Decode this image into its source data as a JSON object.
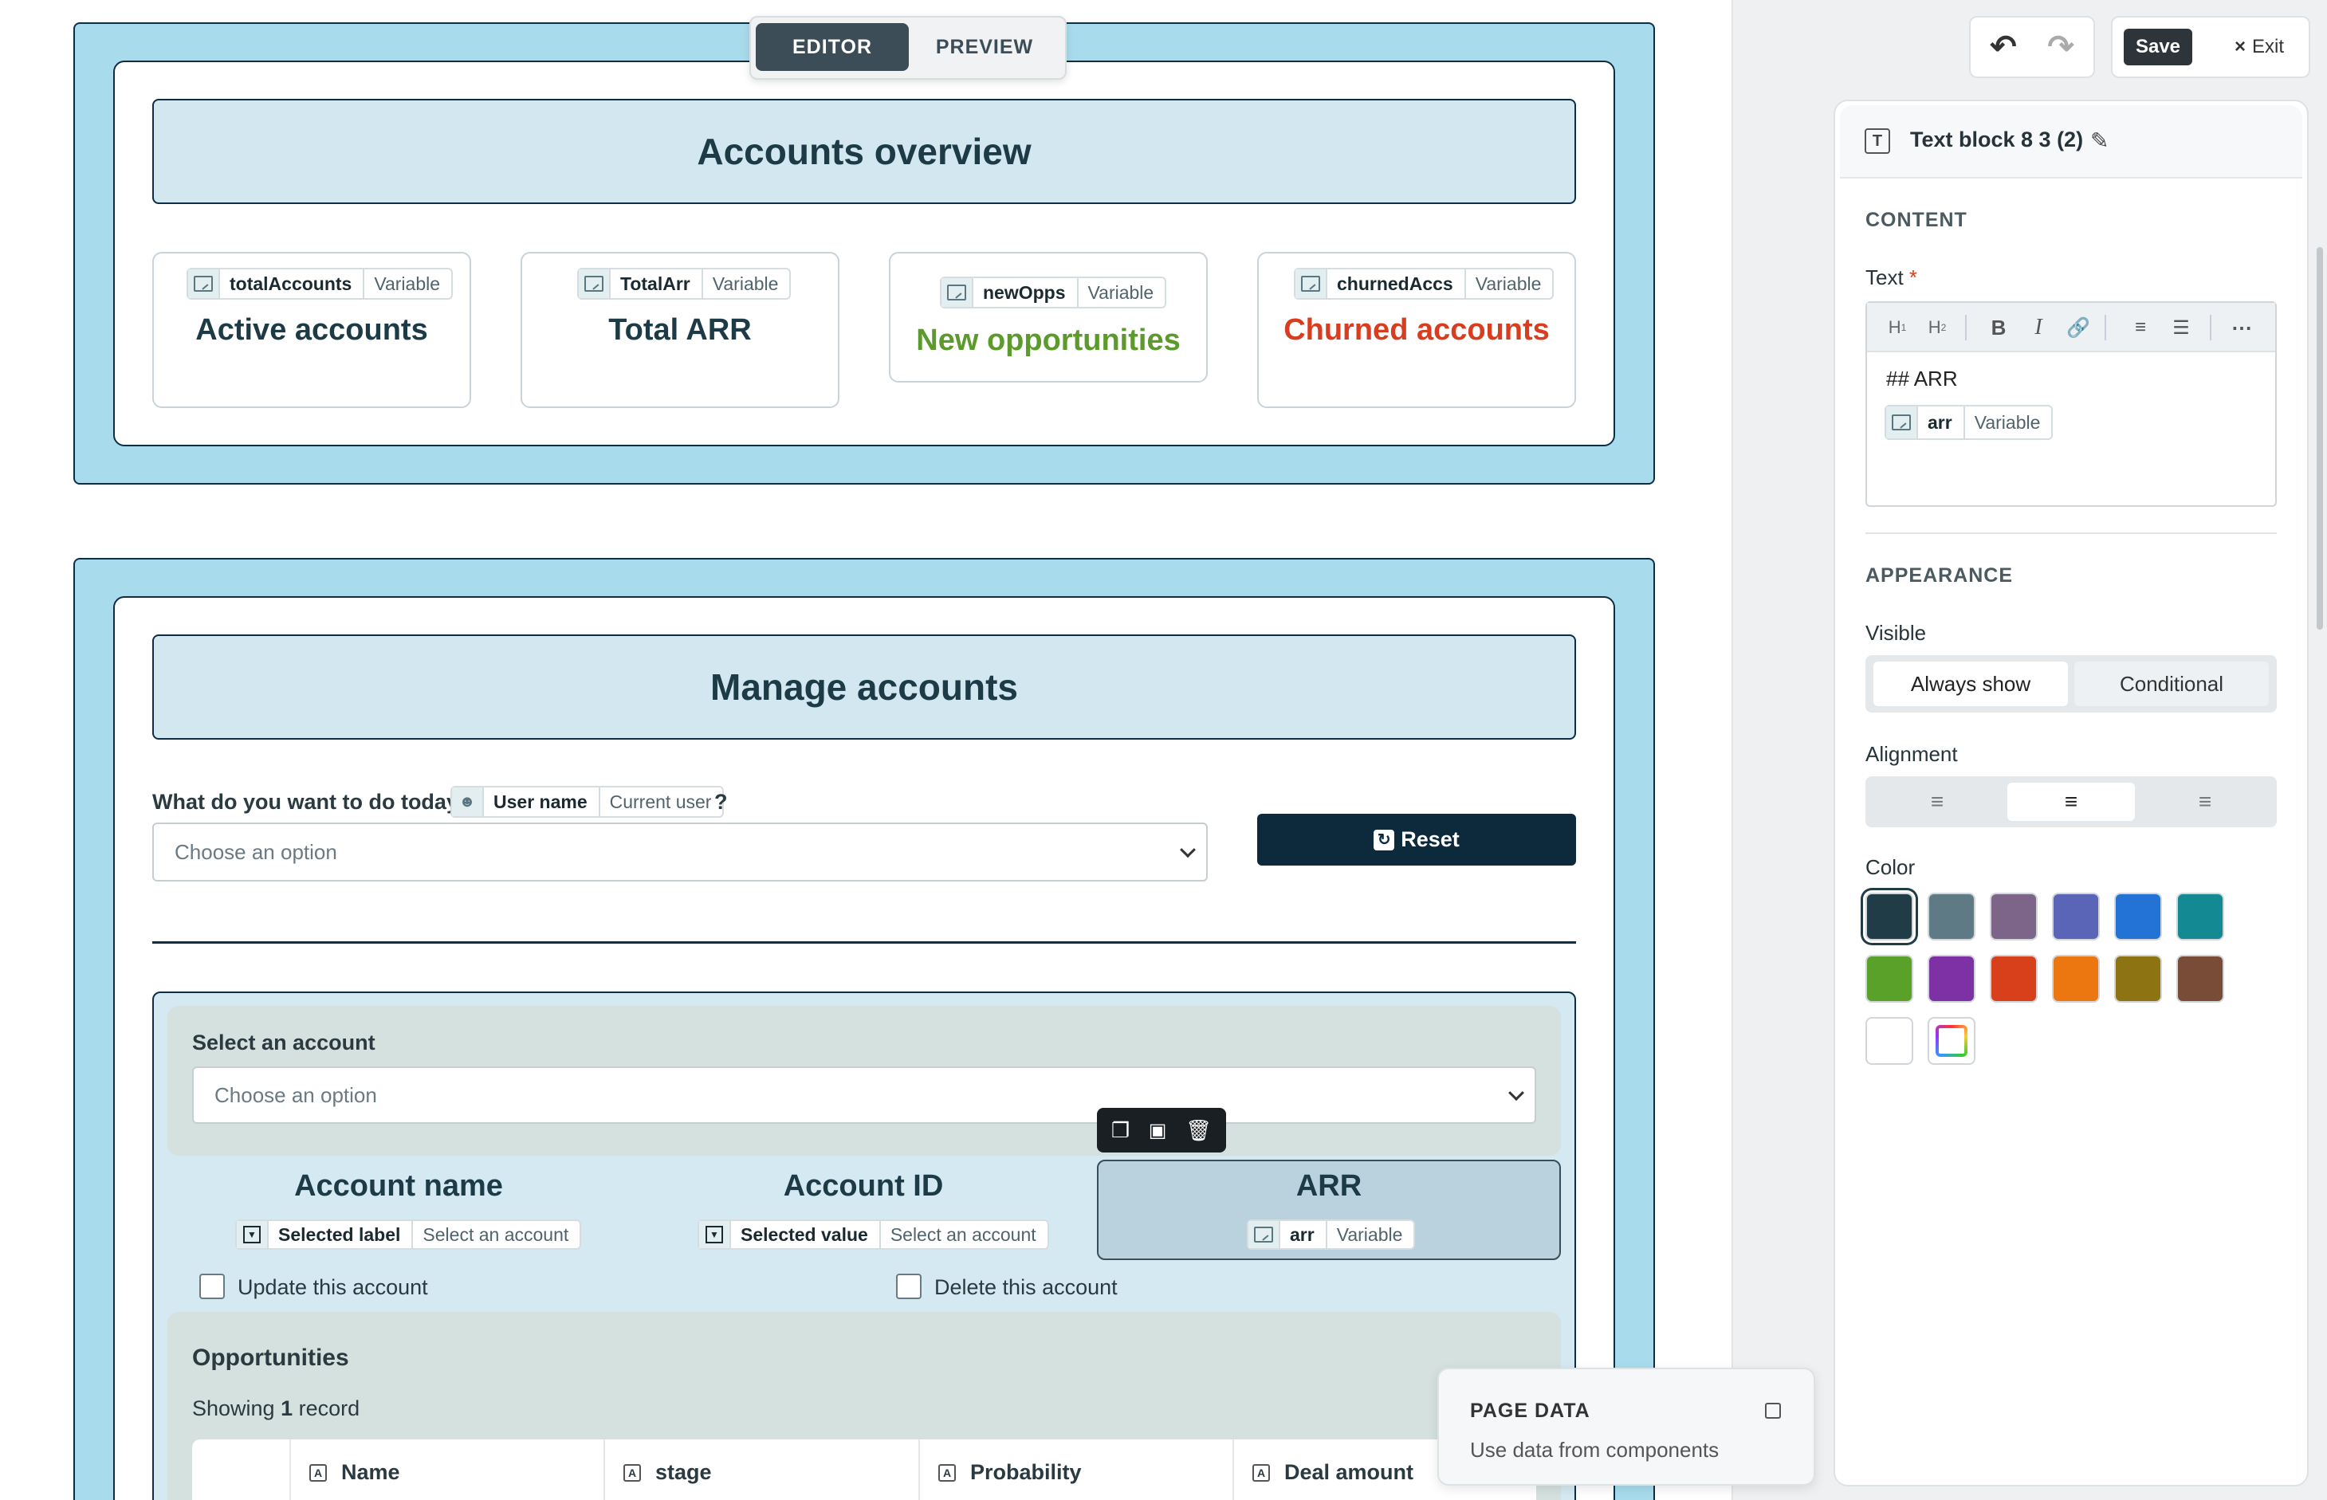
{
  "mode_toggle": {
    "editor": "EDITOR",
    "preview": "PREVIEW"
  },
  "toolbar": {
    "save": "Save",
    "exit": "Exit"
  },
  "overview": {
    "title": "Accounts overview",
    "cards": [
      {
        "var_name": "totalAccounts",
        "var_type": "Variable",
        "label": "Active accounts",
        "color": "#1d3b47"
      },
      {
        "var_name": "TotalArr",
        "var_type": "Variable",
        "label": "Total ARR",
        "color": "#1d3b47"
      },
      {
        "var_name": "newOpps",
        "var_type": "Variable",
        "label": "New opportunities",
        "color": "#5c9a2b"
      },
      {
        "var_name": "churnedAccs",
        "var_type": "Variable",
        "label": "Churned accounts",
        "color": "#d83d1f"
      }
    ]
  },
  "manage": {
    "title": "Manage accounts",
    "question_prefix": "What do you want to do today,",
    "user_chip": {
      "name": "User name",
      "type": "Current user"
    },
    "question_suffix": "?",
    "action_select_placeholder": "Choose an option",
    "reset_label": "Reset",
    "account_select_label": "Select an account",
    "account_select_placeholder": "Choose an option",
    "columns": [
      {
        "heading": "Account name",
        "chip_name": "Selected label",
        "chip_type": "Select an account"
      },
      {
        "heading": "Account ID",
        "chip_name": "Selected value",
        "chip_type": "Select an account"
      },
      {
        "heading": "ARR",
        "chip_name": "arr",
        "chip_type": "Variable"
      }
    ],
    "update_label": "Update this account",
    "delete_label": "Delete this account",
    "opportunities_title": "Opportunities",
    "showing_prefix": "Showing",
    "showing_count": "1",
    "showing_suffix": "record",
    "table_headers": [
      "Name",
      "stage",
      "Probability",
      "Deal amount"
    ]
  },
  "page_data_popup": {
    "title": "PAGE DATA",
    "subtitle": "Use data from components"
  },
  "inspector": {
    "block_name": "Text block 8 3 (2)",
    "content_heading": "CONTENT",
    "text_label": "Text",
    "required_mark": "*",
    "text_value": "## ARR",
    "text_chip": {
      "name": "arr",
      "type": "Variable"
    },
    "editor_tools": [
      "H1",
      "H2",
      "B",
      "I"
    ],
    "appearance_heading": "APPEARANCE",
    "visible_label": "Visible",
    "visible_options": [
      "Always show",
      "Conditional"
    ],
    "visible_selected": "Always show",
    "alignment_label": "Alignment",
    "alignment_selected": "center",
    "color_label": "Color",
    "colors": [
      "#203d47",
      "#5e7a84",
      "#7c6588",
      "#5a65b8",
      "#2373d6",
      "#138a93",
      "#5aa12a",
      "#7d31a4",
      "#d8401c",
      "#ec760f",
      "#8d7311",
      "#784c36",
      "#ffffff",
      "rainbow"
    ],
    "color_selected": "#203d47"
  }
}
